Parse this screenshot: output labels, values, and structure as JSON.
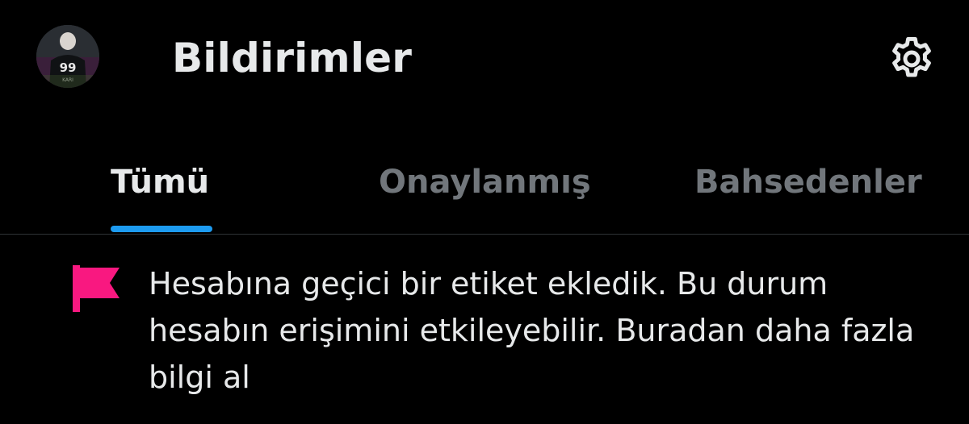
{
  "header": {
    "title": "Bildirimler",
    "avatar_icon": "profile-avatar",
    "settings_icon": "gear-icon"
  },
  "tabs": [
    {
      "label": "Tümü",
      "active": true
    },
    {
      "label": "Onaylanmış",
      "active": false
    },
    {
      "label": "Bahsedenler",
      "active": false
    }
  ],
  "notification": {
    "icon": "flag-icon",
    "text": "Hesabına geçici bir etiket ekledik. Bu durum hesabın erişimini etkileyebilir. Buradan daha fazla bilgi al"
  },
  "colors": {
    "background": "#000000",
    "text_primary": "#e7e9ea",
    "text_secondary": "#71767b",
    "accent": "#1d9bf0",
    "flag": "#f91880",
    "divider": "#2f3336"
  }
}
